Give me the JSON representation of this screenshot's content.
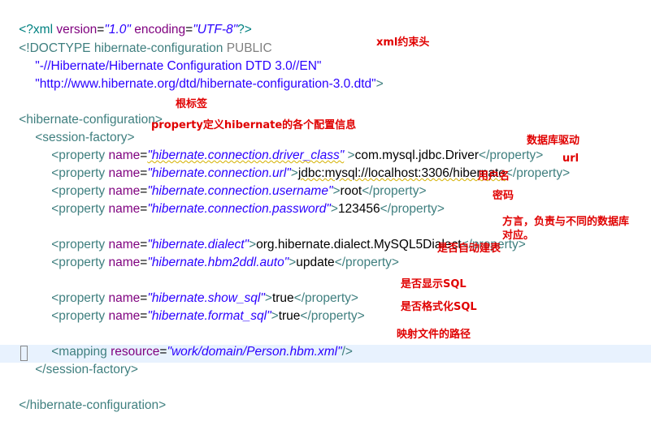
{
  "code": {
    "l1": {
      "a": "<?xml ",
      "b": "version",
      "c": "=",
      "d": "\"1.0\"",
      "e": " encoding",
      "f": "=",
      "g": "\"UTF-8\"",
      "h": "?>"
    },
    "l2": {
      "a": "<!DOCTYPE hibernate-configuration ",
      "b": "PUBLIC"
    },
    "l3": {
      "a": "\"-//Hibernate/Hibernate Configuration DTD 3.0//EN\""
    },
    "l4": {
      "a": "\"http://www.hibernate.org/dtd/hibernate-configuration-3.0.dtd\"",
      "b": ">"
    },
    "l6": {
      "a": "<hibernate-configuration>"
    },
    "l7": {
      "a": "<session-factory>"
    },
    "l8": {
      "a": "<property ",
      "b": "name",
      "c": "=",
      "d": "\"hibernate.connection.driver_class\"",
      "e": " >",
      "f": "com.mysql.jdbc.Driver",
      "g": "</property>"
    },
    "l9": {
      "a": "<property ",
      "b": "name",
      "c": "=",
      "d": "\"hibernate.connection.url\"",
      "e": ">",
      "f": "jdbc:mysql://localhost:3306/hibernate",
      "g": "</property>"
    },
    "l10": {
      "a": "<property ",
      "b": "name",
      "c": "=",
      "d": "\"hibernate.connection.username\"",
      "e": ">",
      "f": "root",
      "g": "</property>"
    },
    "l11": {
      "a": "<property ",
      "b": "name",
      "c": "=",
      "d": "\"hibernate.connection.password\"",
      "e": ">",
      "f": "123456",
      "g": "</property>"
    },
    "l13": {
      "a": "<property ",
      "b": "name",
      "c": "=",
      "d": "\"hibernate.dialect\"",
      "e": ">",
      "f": "org.hibernate.dialect.MySQL5Dialect",
      "g": "</property>"
    },
    "l14": {
      "a": "<property ",
      "b": "name",
      "c": "=",
      "d": "\"hibernate.hbm2ddl.auto\"",
      "e": ">",
      "f": "update",
      "g": "</property>"
    },
    "l16": {
      "a": "<property ",
      "b": "name",
      "c": "=",
      "d": "\"hibernate.show_sql\"",
      "e": ">",
      "f": "true",
      "g": "</property>"
    },
    "l17": {
      "a": "<property ",
      "b": "name",
      "c": "=",
      "d": "\"hibernate.format_sql\"",
      "e": ">",
      "f": "true",
      "g": "</property>"
    },
    "l19": {
      "a": "<mapping ",
      "b": "resource",
      "c": "=",
      "d": "\"work/domain/Person.hbm.xml\"",
      "e": "/>"
    },
    "l20": {
      "a": "</session-factory>"
    },
    "l22": {
      "a": "</hibernate-configuration>"
    }
  },
  "annotations": {
    "header": "xml约束头",
    "root": "根标签",
    "property_info": "property定义hibernate的各个配置信息",
    "driver": "数据库驱动",
    "url": "url",
    "user": "用户名",
    "password": "密码",
    "dialect1": "方言，负责与不同的数据库",
    "dialect2": "对应。",
    "ddl": "是否自动建表",
    "show_sql": "是否显示SQL",
    "format_sql": "是否格式化SQL",
    "mapping": "映射文件的路径"
  }
}
